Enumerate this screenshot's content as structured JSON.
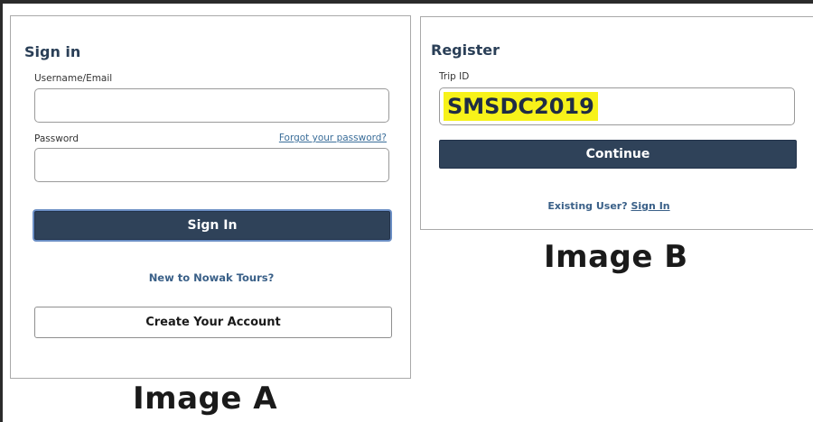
{
  "image_a": {
    "caption": "Image A",
    "title": "Sign in",
    "username_label": "Username/Email",
    "username_value": "",
    "password_label": "Password",
    "password_value": "",
    "forgot_password": "Forgot your password?",
    "sign_in_button": "Sign In",
    "new_prompt": "New to Nowak Tours?",
    "create_account_button": "Create Your Account"
  },
  "image_b": {
    "caption": "Image B",
    "title": "Register",
    "trip_id_label": "Trip ID",
    "trip_id_value": "SMSDC2019",
    "continue_button": "Continue",
    "existing_user_text": "Existing User?",
    "sign_in_link": "Sign In"
  },
  "colors": {
    "primary_button": "#2f4259",
    "link": "#3a6088",
    "highlight": "#f7f21a"
  }
}
